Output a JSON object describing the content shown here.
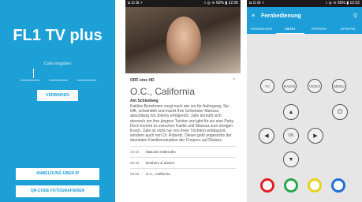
{
  "screen1": {
    "title": "FL1 TV plus",
    "code_label": "Code eingeben",
    "connect_label": "VERBINDEN",
    "ip_button": "ANMELDUNG ÜBER IP",
    "qr_button": "QR-CODE FOTOGRAFIEREN",
    "colors": {
      "background": "#1da0d6"
    }
  },
  "screen2": {
    "status": {
      "left": "◘ ⊡ ⊞ ⚡",
      "right": "☇ ◎ ≋ 63% ▮ 12:36"
    },
    "channel": "ORF eins HD",
    "show": "O.C., California",
    "episode": "Am Schiedweg",
    "description": "Kaitlins Benehmen sorgt nach wie vor für Aufregung. Sie kifft, schwindelt und macht ihre Schwester Marissa abschätzig mit Johnny erfolgreich. Julie bemüht sich dennoch um ihre jüngere Tochter und gibt für sie eine Party. Doch kommt es zwischen Kaitlin und Marissa zum riesigen Krach. Julie ist nicht nur von ihren Töchtern enttäuscht, sondern auch von Dr. Roberts. Dieser geht angesichts der desolaten Familiensituation der Coopers auf Distanz.",
    "schedule": [
      {
        "time": "10:15",
        "name": "Malcolm mittendrin"
      },
      {
        "time": "09:35",
        "name": "Brothers & Sisters"
      },
      {
        "time": "08:50",
        "name": "O.C., California"
      }
    ]
  },
  "screen3": {
    "status": {
      "left": "◘ ⊡ ⊞ ⚡",
      "right": "☇ ◎ ≋ 65% ▮ 12:32"
    },
    "title": "Fernbedienung",
    "tabs": [
      "FERNSEHEN",
      "MENÜ",
      "ZIFFERN",
      "STREAM"
    ],
    "active_tab": "MENÜ",
    "buttons": {
      "tv": "TV",
      "radio": "RADIO",
      "video": "VIDEO",
      "menu": "MENU",
      "ok": "OK"
    },
    "color_buttons": [
      "#e02020",
      "#2aa84a",
      "#e8d21a",
      "#1e6fd8"
    ],
    "accent": "#1e9ed8"
  }
}
